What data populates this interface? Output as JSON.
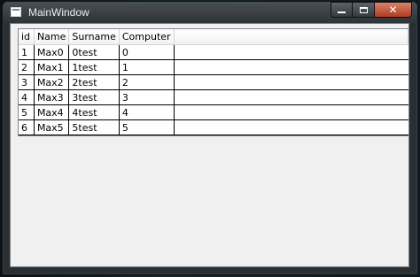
{
  "window": {
    "title": "MainWindow",
    "controls": {
      "minimize_icon": "minimize-icon",
      "maximize_icon": "maximize-icon",
      "close_icon": "close-icon"
    }
  },
  "grid": {
    "columns": [
      "id",
      "Name",
      "Surname",
      "Computer"
    ],
    "rows": [
      [
        "1",
        "Max0",
        "0test",
        "0"
      ],
      [
        "2",
        "Max1",
        "1test",
        "1"
      ],
      [
        "3",
        "Max2",
        "2test",
        "2"
      ],
      [
        "4",
        "Max3",
        "3test",
        "3"
      ],
      [
        "5",
        "Max4",
        "4test",
        "4"
      ],
      [
        "6",
        "Max5",
        "5test",
        "5"
      ]
    ]
  }
}
